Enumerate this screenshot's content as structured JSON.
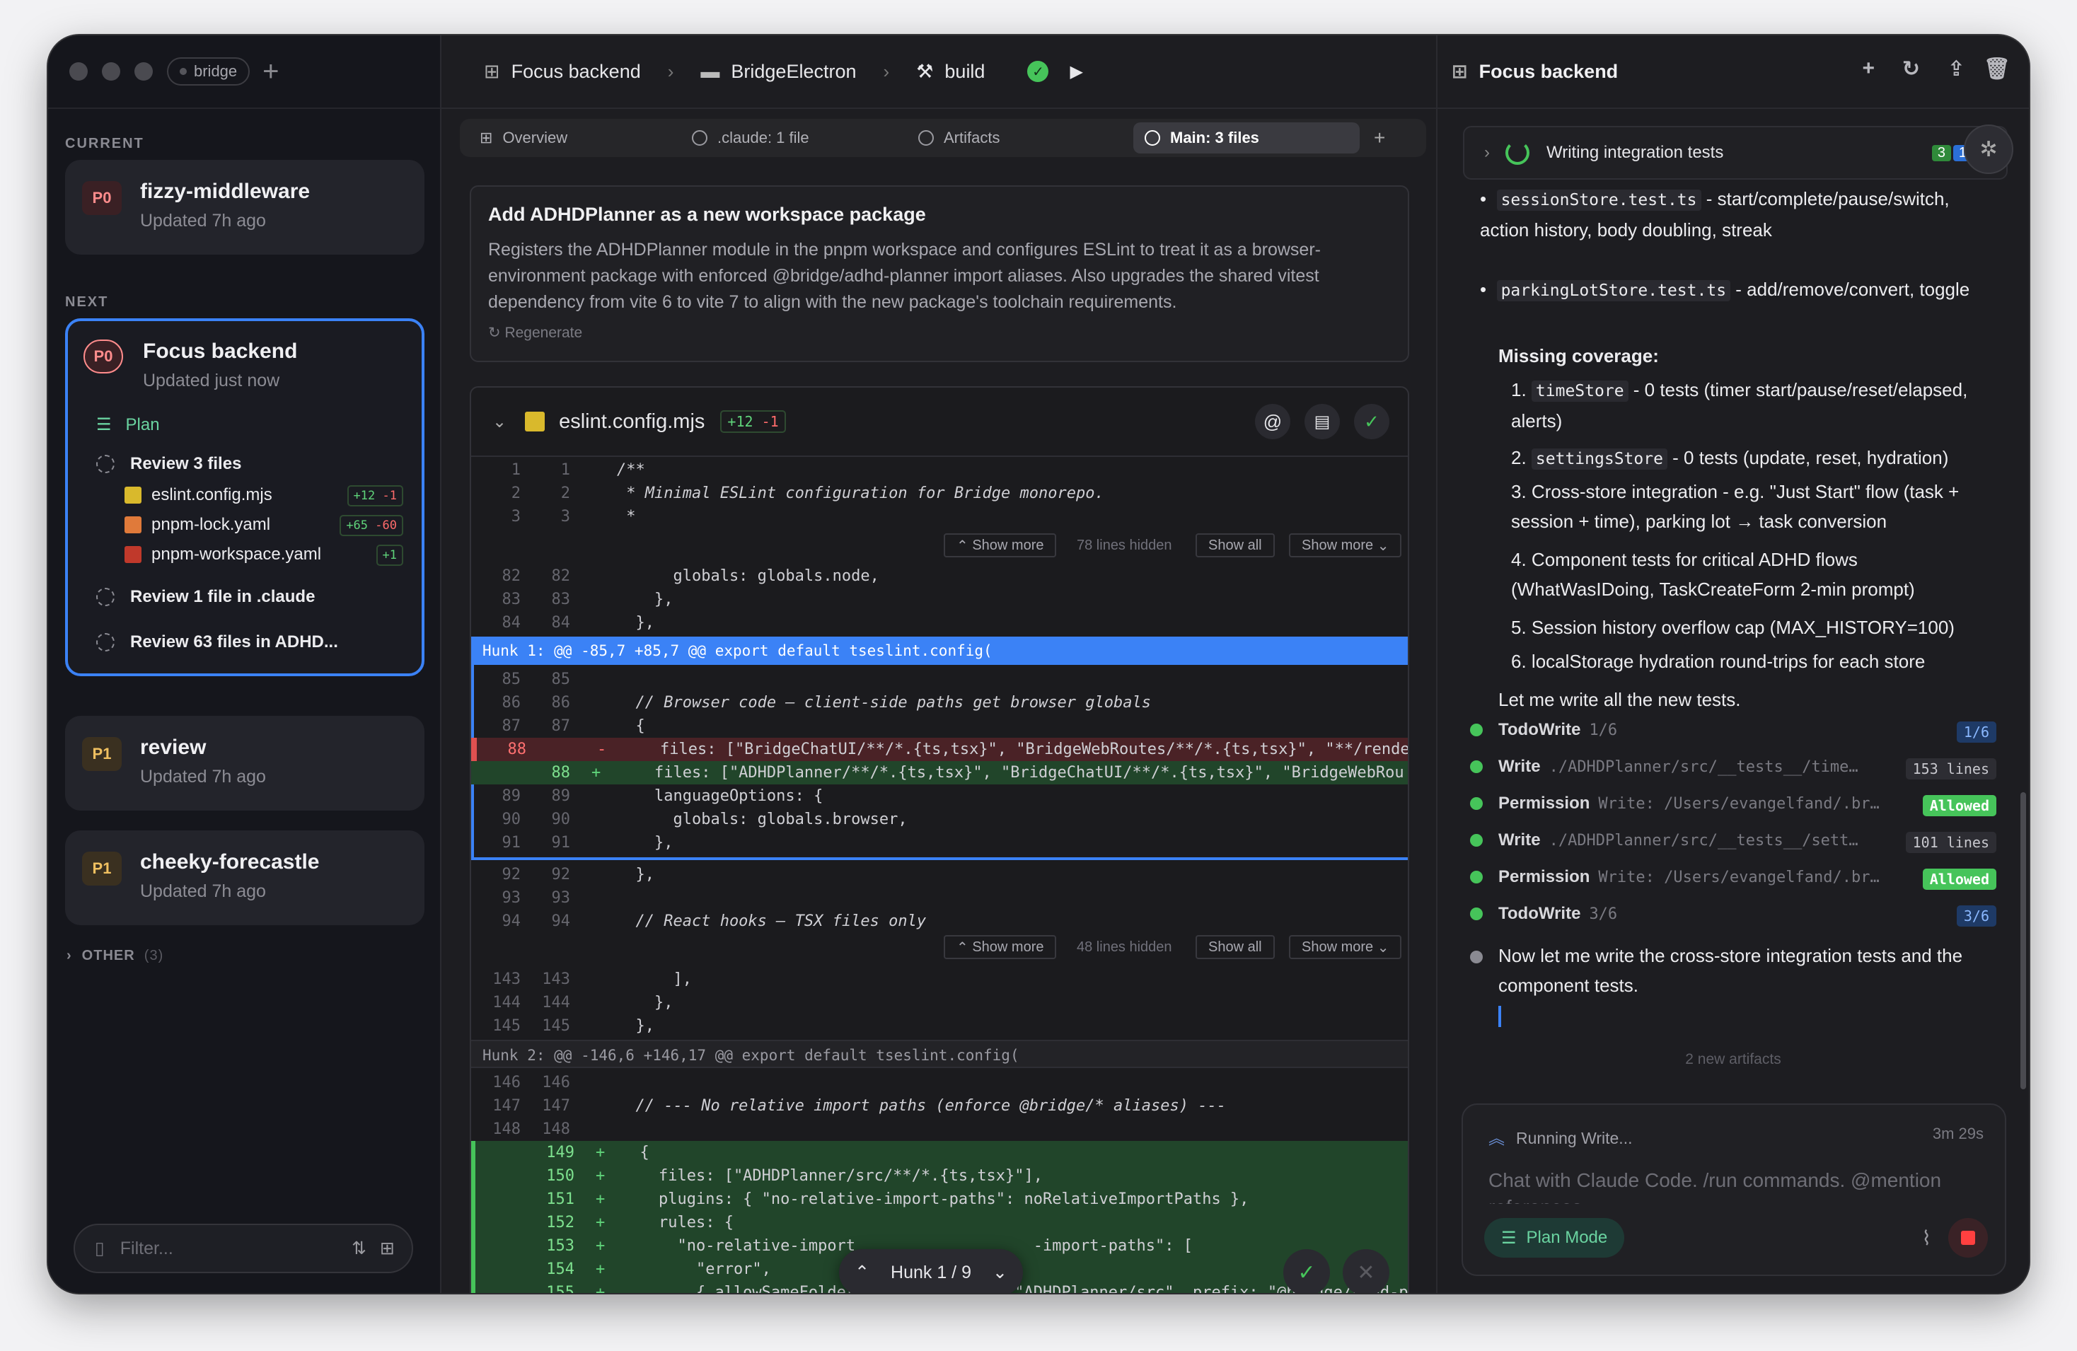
{
  "sidebar": {
    "workspace_pill": "bridge",
    "current_label": "CURRENT",
    "next_label": "NEXT",
    "current": {
      "badge": "P0",
      "title": "fizzy-middleware",
      "updated": "Updated 7h ago"
    },
    "active": {
      "badge": "P0",
      "title": "Focus backend",
      "updated": "Updated just now",
      "plan": "Plan",
      "review_files": "Review 3 files",
      "files": [
        {
          "name": "eslint.config.mjs",
          "add": "+12",
          "del": "-1"
        },
        {
          "name": "pnpm-lock.yaml",
          "add": "+65",
          "del": "-60"
        },
        {
          "name": "pnpm-workspace.yaml",
          "add": "+1",
          "del": ""
        }
      ],
      "review_claude": "Review 1 file in .claude",
      "review_adhd": "Review 63 files in ADHD..."
    },
    "others": [
      {
        "badge": "P1",
        "title": "review",
        "updated": "Updated 7h ago"
      },
      {
        "badge": "P1",
        "title": "cheeky-forecastle",
        "updated": "Updated 7h ago"
      }
    ],
    "other_section": "OTHER",
    "other_count": "(3)",
    "filter_placeholder": "Filter..."
  },
  "center": {
    "breadcrumbs": [
      "Focus backend",
      "BridgeElectron",
      "build"
    ],
    "tabs": [
      "Overview",
      ".claude: 1 file",
      "Artifacts",
      "Main: 3 files"
    ],
    "summary_title": "Add ADHDPlanner as a new workspace package",
    "summary_body": "Registers the ADHDPlanner module in the pnpm workspace and configures ESLint to treat it as a browser-environment package with enforced @bridge/adhd-planner import aliases. Also upgrades the shared vitest dependency from vite 6 to vite 7 to align with the new package's toolchain requirements.",
    "regenerate": "Regenerate",
    "file_name": "eslint.config.mjs",
    "file_add": "+12",
    "file_del": "-1",
    "show_more": "Show more",
    "show_all": "Show all",
    "hidden1": "78 lines hidden",
    "hidden2": "48 lines hidden",
    "hunk1": "Hunk 1: @@ -85,7 +85,7 @@ export default tseslint.config(",
    "hunk2": "Hunk 2: @@ -146,6 +146,17 @@ export default tseslint.config(",
    "hunk_nav": "Hunk 1 / 9",
    "lines": {
      "l1": {
        "a": "1",
        "b": "1",
        "t": "/**"
      },
      "l2": {
        "a": "2",
        "b": "2",
        "t": " * Minimal ESLint configuration for Bridge monorepo."
      },
      "l3": {
        "a": "3",
        "b": "3",
        "t": " *"
      },
      "l82": {
        "a": "82",
        "b": "82",
        "t": "      globals: globals.node,"
      },
      "l83": {
        "a": "83",
        "b": "83",
        "t": "    },"
      },
      "l84": {
        "a": "84",
        "b": "84",
        "t": "  },"
      },
      "l85": {
        "a": "85",
        "b": "85",
        "t": ""
      },
      "l86": {
        "a": "86",
        "b": "86",
        "t": "  // Browser code — client-side paths get browser globals"
      },
      "l87": {
        "a": "87",
        "b": "87",
        "t": "  {"
      },
      "l88d": {
        "a": "88",
        "b": "",
        "m": "-",
        "t": "    files: [\"BridgeChatUI/**/*.{ts,tsx}\", \"BridgeWebRoutes/**/*.{ts,tsx}\", \"**/rende"
      },
      "l88a": {
        "a": "",
        "b": "88",
        "m": "+",
        "t": "    files: [\"ADHDPlanner/**/*.{ts,tsx}\", \"BridgeChatUI/**/*.{ts,tsx}\", \"BridgeWebRou"
      },
      "l89": {
        "a": "89",
        "b": "89",
        "t": "    languageOptions: {"
      },
      "l90": {
        "a": "90",
        "b": "90",
        "t": "      globals: globals.browser,"
      },
      "l91": {
        "a": "91",
        "b": "91",
        "t": "    },"
      },
      "l92": {
        "a": "92",
        "b": "92",
        "t": "  },"
      },
      "l93": {
        "a": "93",
        "b": "93",
        "t": ""
      },
      "l94": {
        "a": "94",
        "b": "94",
        "t": "  // React hooks — TSX files only"
      },
      "l143": {
        "a": "143",
        "b": "143",
        "t": "      ],"
      },
      "l144": {
        "a": "144",
        "b": "144",
        "t": "    },"
      },
      "l145": {
        "a": "145",
        "b": "145",
        "t": "  },"
      },
      "l146": {
        "a": "146",
        "b": "146",
        "t": ""
      },
      "l147": {
        "a": "147",
        "b": "147",
        "t": "  // --- No relative import paths (enforce @bridge/* aliases) ---"
      },
      "l148": {
        "a": "148",
        "b": "148",
        "t": ""
      },
      "l149": {
        "a": "",
        "b": "149",
        "m": "+",
        "t": "  {"
      },
      "l150": {
        "a": "",
        "b": "150",
        "m": "+",
        "t": "    files: [\"ADHDPlanner/src/**/*.{ts,tsx}\"],"
      },
      "l151": {
        "a": "",
        "b": "151",
        "m": "+",
        "t": "    plugins: { \"no-relative-import-paths\": noRelativeImportPaths },"
      },
      "l152": {
        "a": "",
        "b": "152",
        "m": "+",
        "t": "    rules: {"
      },
      "l153": {
        "a": "",
        "b": "153",
        "m": "+",
        "t": "      \"no-relative-import                   -import-paths\": ["
      },
      "l154": {
        "a": "",
        "b": "154",
        "m": "+",
        "t": "        \"error\","
      },
      "l155": {
        "a": "",
        "b": "155",
        "m": "+",
        "t": "        { allowSameFolder: true, rootDir: \"ADHDPlanner/src\", prefix: \"@bridge/adhd-p"
      }
    }
  },
  "right": {
    "title": "Focus backend",
    "task": "Writing integration tests",
    "task_counts": [
      "3",
      "1"
    ],
    "bullets": [
      {
        "code": "sessionStore.test.ts",
        "text": " - start/complete/pause/switch, action history, body doubling, streak"
      },
      {
        "code": "parkingLotStore.test.ts",
        "text": " - add/remove/convert, toggle"
      }
    ],
    "missing_heading": "Missing coverage:",
    "missing": [
      {
        "num": "1.",
        "code": "timeStore",
        "text": " - 0 tests (timer start/pause/reset/elapsed, alerts)"
      },
      {
        "num": "2.",
        "code": "settingsStore",
        "text": " - 0 tests (update, reset, hydration)"
      },
      {
        "num": "3.",
        "code": "",
        "text": "Cross-store integration - e.g. \"Just Start\" flow (task + session + time), parking lot → task conversion"
      },
      {
        "num": "4.",
        "code": "",
        "text": "Component tests for critical ADHD flows (WhatWasIDoing, TaskCreateForm 2-min prompt)"
      },
      {
        "num": "5.",
        "code": "",
        "text": "Session history overflow cap (MAX_HISTORY=100)"
      },
      {
        "num": "6.",
        "code": "",
        "text": "localStorage hydration round-trips for each store"
      }
    ],
    "let_me": "Let me write all the new tests.",
    "events": [
      {
        "kind": "TodoWrite",
        "detail": "1/6",
        "tag": "1/6",
        "tag_type": "blue"
      },
      {
        "kind": "Write",
        "detail": "./ADHDPlanner/src/__tests__/time…",
        "tag": "153 lines",
        "tag_type": "gray"
      },
      {
        "kind": "Permission",
        "detail": "Write: /Users/evangelfand/.br…",
        "tag": "Allowed",
        "tag_type": "green"
      },
      {
        "kind": "Write",
        "detail": "./ADHDPlanner/src/__tests__/sett…",
        "tag": "101 lines",
        "tag_type": "gray"
      },
      {
        "kind": "Permission",
        "detail": "Write: /Users/evangelfand/.br…",
        "tag": "Allowed",
        "tag_type": "green"
      },
      {
        "kind": "TodoWrite",
        "detail": "3/6",
        "tag": "3/6",
        "tag_type": "blue"
      }
    ],
    "now_text": "Now let me write the cross-store integration tests and the component tests.",
    "artifacts": "2 new artifacts",
    "running": "Running Write...",
    "elapsed": "3m 29s",
    "chat_placeholder": "Chat with Claude Code. /run commands. @mention references",
    "plan_mode": "Plan Mode"
  },
  "colors": {
    "accent": "#3b82f6",
    "add": "#21452a",
    "del": "#4a2226",
    "green": "#46c45a"
  }
}
